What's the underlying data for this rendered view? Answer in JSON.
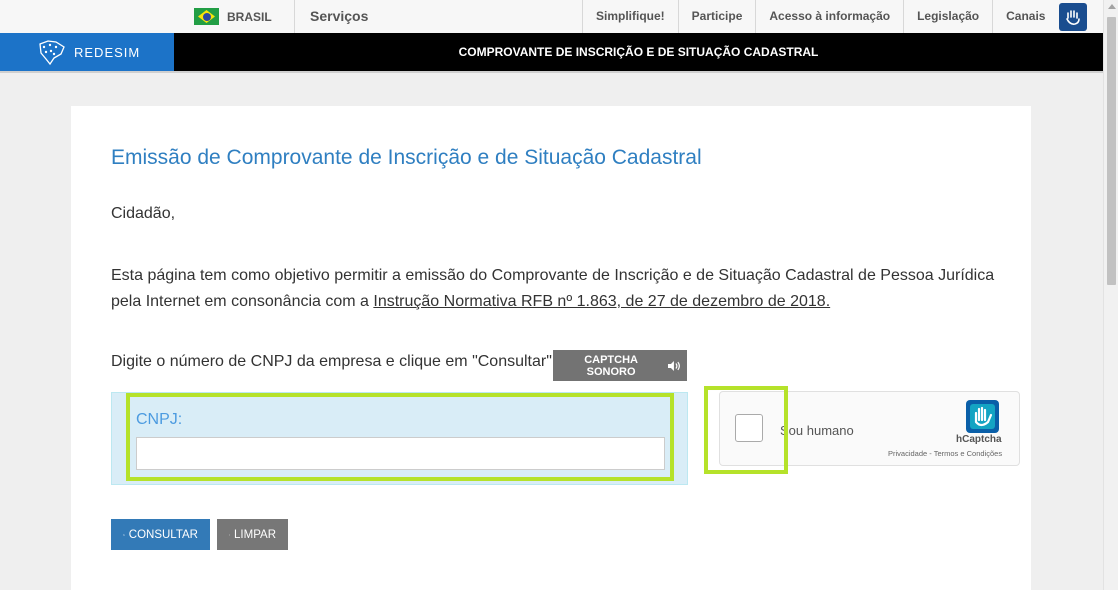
{
  "gov_bar": {
    "country": "BRASIL",
    "services": "Serviços",
    "links": [
      "Simplifique!",
      "Participe",
      "Acesso à informação",
      "Legislação",
      "Canais"
    ]
  },
  "redesim": {
    "logo_text": "REDESIM",
    "page_heading": "COMPROVANTE DE INSCRIÇÃO E DE SITUAÇÃO CADASTRAL"
  },
  "main": {
    "title": "Emissão de Comprovante de Inscrição e de Situação Cadastral",
    "greeting": "Cidadão,",
    "description_text": "Esta página tem como objetivo permitir a emissão do Comprovante de Inscrição e de Situação Cadastral de Pessoa Jurídica pela Internet em consonância com a ",
    "description_link": "Instrução Normativa RFB nº 1.863, de 27 de dezembro de 2018.",
    "instruction": "Digite o número de CNPJ da empresa e clique em \"Consultar\".",
    "audio_captcha_label": "CAPTCHA SONORO",
    "cnpj_label": "CNPJ:",
    "cnpj_value": ""
  },
  "captcha": {
    "label": "Sou humano",
    "brand": "hCaptcha",
    "links": "Privacidade - Termos e Condições"
  },
  "buttons": {
    "consultar": "CONSULTAR",
    "limpar": "LIMPAR"
  },
  "colors": {
    "accent_blue": "#2f7fc1",
    "redesim_blue": "#1c73c8",
    "highlight": "#b5e22a",
    "panel_bg": "#d9edf7"
  }
}
